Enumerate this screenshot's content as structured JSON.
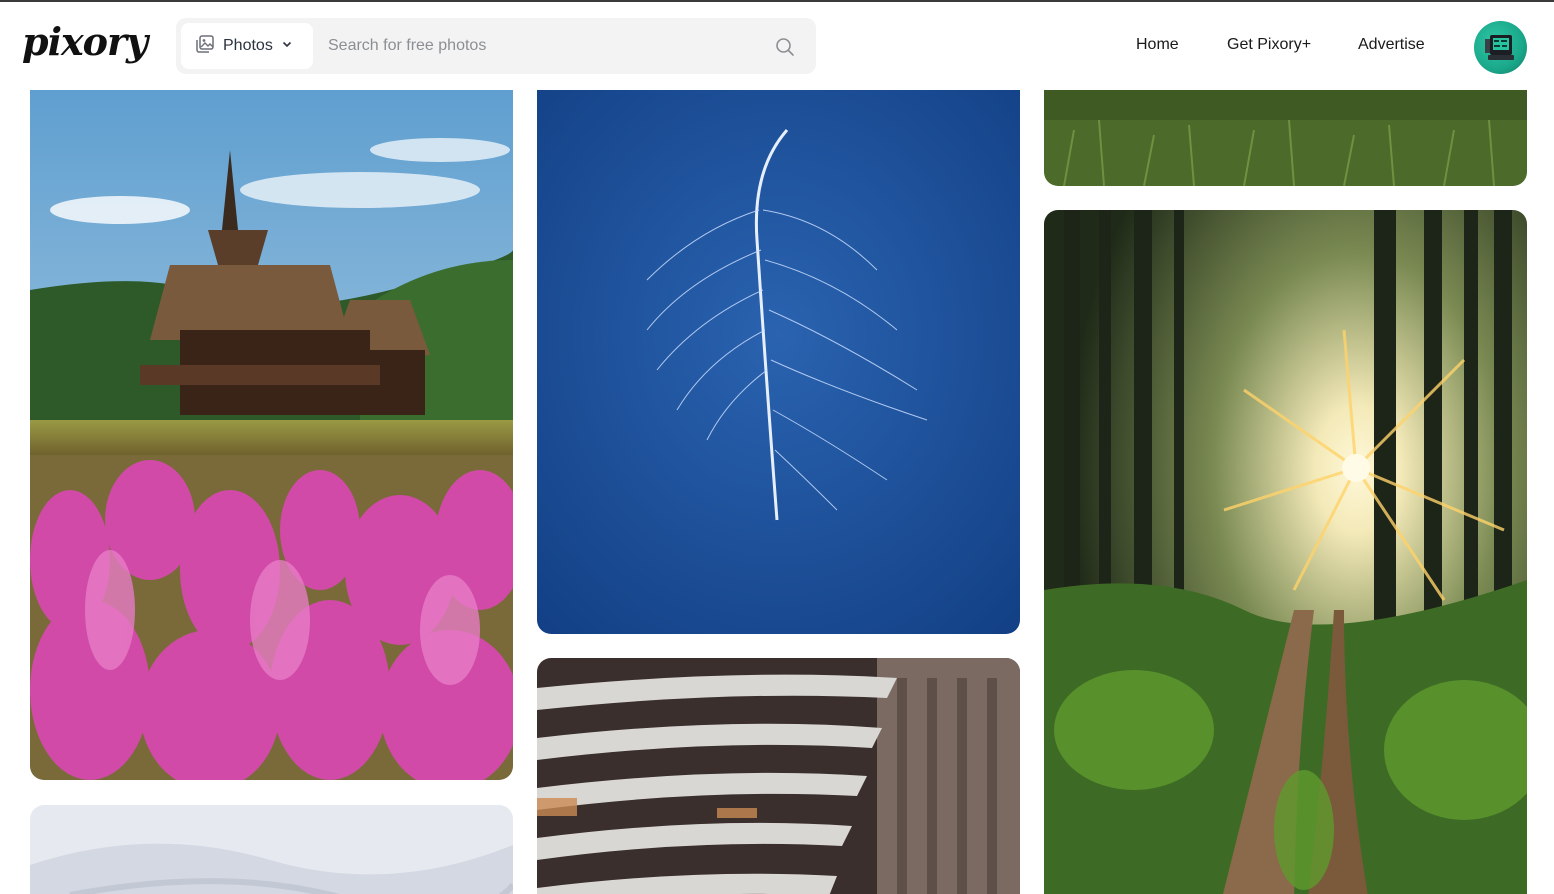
{
  "brand": {
    "logo_text": "pixory"
  },
  "search": {
    "type_label": "Photos",
    "placeholder": "Search for free photos",
    "value": ""
  },
  "nav": {
    "items": [
      {
        "label": "Home"
      },
      {
        "label": "Get Pixory+"
      },
      {
        "label": "Advertise"
      }
    ]
  },
  "photos": [
    {
      "subject": "stave church with pink fireweed meadow"
    },
    {
      "subject": "snowy white landscape"
    },
    {
      "subject": "white feather on deep blue background"
    },
    {
      "subject": "curved metal canopy beside city building"
    },
    {
      "subject": "green grass field"
    },
    {
      "subject": "sun rays through forest trees over dirt path"
    }
  ],
  "colors": {
    "accent_avatar": "#1aa88a",
    "feather_bg": "#1a4f9a",
    "fireweed": "#d14aa8"
  }
}
